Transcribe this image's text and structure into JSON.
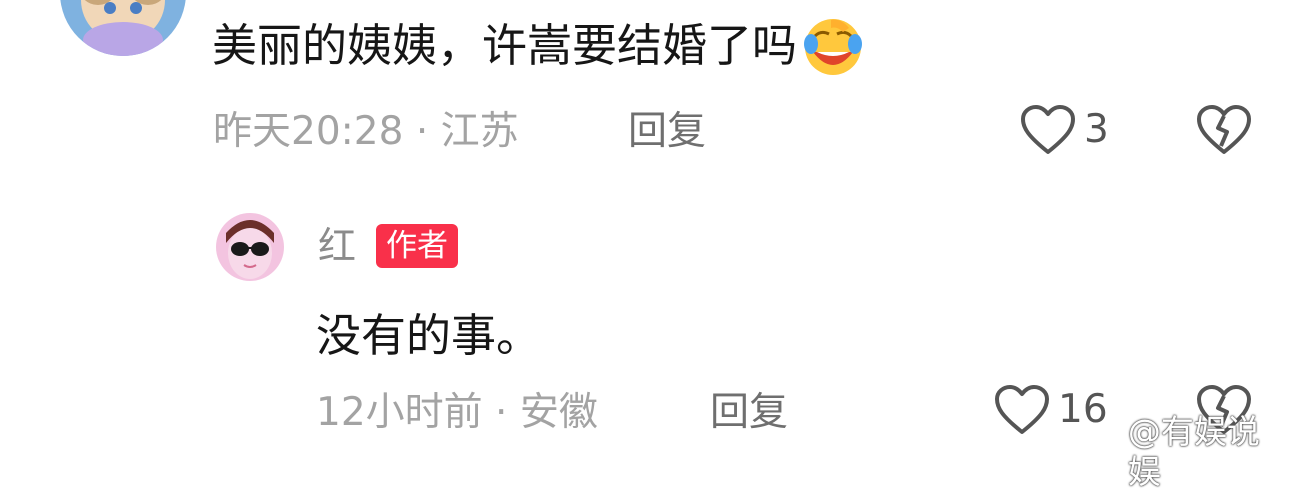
{
  "top_comment": {
    "text": "美丽的姨姨，许嵩要结婚了吗",
    "emoji": "laughing-tears-emoji",
    "time": "昨天20:28",
    "location": "江苏",
    "reply_label": "回复",
    "likes": "3"
  },
  "reply": {
    "author": "红",
    "badge": "作者",
    "text": "没有的事。",
    "time": "12小时前",
    "location": "安徽",
    "reply_label": "回复",
    "likes": "16"
  },
  "watermark": "@有娱说娱",
  "colors": {
    "badge": "#f9304a",
    "meta": "#a3a3a3",
    "text": "#161616"
  }
}
